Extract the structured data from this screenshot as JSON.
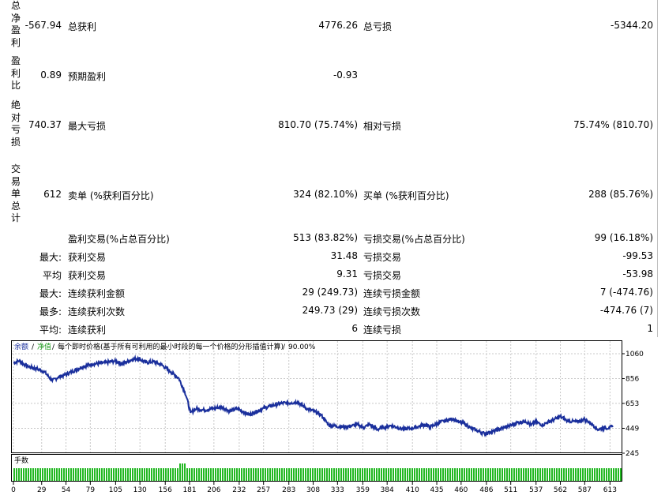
{
  "summary": {
    "net_profit": {
      "vlabel": "总净盈利",
      "value": "-567.94",
      "gross_profit_label": "总获利",
      "gross_profit": "4776.26",
      "gross_loss_label": "总亏损",
      "gross_loss": "-5344.20"
    },
    "profit_factor": {
      "vlabel": "盈利比",
      "value": "0.89",
      "expected_label": "预期盈利",
      "expected": "-0.93"
    },
    "abs_drawdown": {
      "vlabel": "绝对亏损",
      "value": "740.37",
      "max_dd_label": "最大亏损",
      "max_dd": "810.70 (75.74%)",
      "rel_dd_label": "相对亏损",
      "rel_dd": "75.74% (810.70)"
    },
    "total_trades": {
      "vlabel": "交易单总计",
      "value": "612",
      "short_label": "卖单 (%获利百分比)",
      "short": "324 (82.10%)",
      "long_label": "买单 (%获利百分比)",
      "long": "288 (85.76%)"
    },
    "profit_trades": {
      "label": "盈利交易(%占总百分比)",
      "value": "513 (83.82%)",
      "loss_label": "亏损交易(%占总百分比)",
      "loss": "99 (16.18%)"
    },
    "largest": {
      "prefix": "最大:",
      "label": "获利交易",
      "value": "31.48",
      "loss_label": "亏损交易",
      "loss": "-99.53"
    },
    "average": {
      "prefix": "平均",
      "label": "获利交易",
      "value": "9.31",
      "loss_label": "亏损交易",
      "loss": "-53.98"
    },
    "max_consec": {
      "prefix": "最大:",
      "label": "连续获利金额",
      "value": "29 (249.73)",
      "loss_label": "连续亏损金额",
      "loss": "7 (-474.76)"
    },
    "max_consec_count": {
      "prefix": "最多:",
      "label": "连续获利次数",
      "value": "249.73 (29)",
      "loss_label": "连续亏损次数",
      "loss": "-474.76 (7)"
    },
    "avg_consec": {
      "prefix": "平均:",
      "label": "连续获利",
      "value": "6",
      "loss_label": "连续亏损",
      "loss": "1"
    }
  },
  "chart_data": {
    "type": "line",
    "legend": {
      "balance": "余额",
      "equity": "净值",
      "description": "每个即时价格(基于所有可利用的最小时段的每一个价格的分形插值计算)",
      "quality": "90.00%"
    },
    "y_ticks": [
      "1060",
      "856",
      "653",
      "449",
      "245"
    ],
    "x_ticks": [
      "0",
      "29",
      "54",
      "79",
      "105",
      "130",
      "156",
      "181",
      "206",
      "232",
      "257",
      "283",
      "308",
      "333",
      "359",
      "384",
      "410",
      "435",
      "460",
      "486",
      "511",
      "537",
      "562",
      "587",
      "613"
    ],
    "ylim": [
      245,
      1060
    ],
    "xlim": [
      0,
      620
    ],
    "balance_anchors": [
      [
        0,
        985
      ],
      [
        6,
        1003
      ],
      [
        12,
        968
      ],
      [
        18,
        948
      ],
      [
        26,
        932
      ],
      [
        32,
        910
      ],
      [
        40,
        838
      ],
      [
        46,
        868
      ],
      [
        52,
        885
      ],
      [
        60,
        912
      ],
      [
        72,
        958
      ],
      [
        82,
        975
      ],
      [
        96,
        988
      ],
      [
        104,
        1000
      ],
      [
        112,
        978
      ],
      [
        122,
        1012
      ],
      [
        128,
        1023
      ],
      [
        136,
        988
      ],
      [
        144,
        995
      ],
      [
        152,
        970
      ],
      [
        162,
        910
      ],
      [
        170,
        858
      ],
      [
        176,
        748
      ],
      [
        178,
        700
      ],
      [
        182,
        575
      ],
      [
        188,
        610
      ],
      [
        196,
        598
      ],
      [
        206,
        612
      ],
      [
        214,
        625
      ],
      [
        222,
        590
      ],
      [
        230,
        610
      ],
      [
        236,
        585
      ],
      [
        242,
        560
      ],
      [
        248,
        580
      ],
      [
        256,
        610
      ],
      [
        266,
        636
      ],
      [
        276,
        655
      ],
      [
        286,
        658
      ],
      [
        292,
        665
      ],
      [
        296,
        640
      ],
      [
        302,
        608
      ],
      [
        310,
        585
      ],
      [
        316,
        560
      ],
      [
        324,
        475
      ],
      [
        332,
        466
      ],
      [
        340,
        460
      ],
      [
        348,
        470
      ],
      [
        354,
        478
      ],
      [
        360,
        455
      ],
      [
        366,
        482
      ],
      [
        374,
        440
      ],
      [
        380,
        456
      ],
      [
        388,
        472
      ],
      [
        394,
        458
      ],
      [
        400,
        443
      ],
      [
        408,
        448
      ],
      [
        416,
        462
      ],
      [
        422,
        480
      ],
      [
        428,
        460
      ],
      [
        436,
        490
      ],
      [
        442,
        508
      ],
      [
        452,
        528
      ],
      [
        458,
        498
      ],
      [
        464,
        485
      ],
      [
        470,
        450
      ],
      [
        476,
        432
      ],
      [
        484,
        405
      ],
      [
        490,
        418
      ],
      [
        498,
        438
      ],
      [
        504,
        455
      ],
      [
        510,
        470
      ],
      [
        518,
        496
      ],
      [
        526,
        509
      ],
      [
        532,
        474
      ],
      [
        536,
        503
      ],
      [
        544,
        476
      ],
      [
        548,
        496
      ],
      [
        556,
        522
      ],
      [
        562,
        545
      ],
      [
        568,
        515
      ],
      [
        574,
        505
      ],
      [
        580,
        500
      ],
      [
        586,
        525
      ],
      [
        590,
        508
      ],
      [
        596,
        475
      ],
      [
        600,
        440
      ],
      [
        606,
        450
      ],
      [
        612,
        455
      ],
      [
        616,
        460
      ]
    ],
    "volume_label": "手数"
  }
}
